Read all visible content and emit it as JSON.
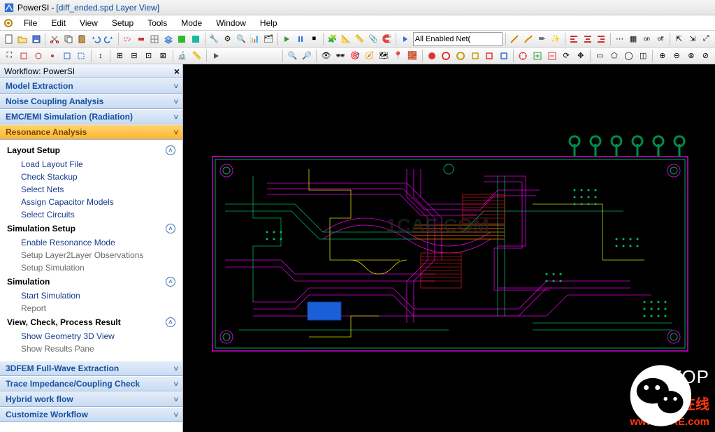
{
  "title": {
    "app": "PowerSI",
    "doc": "[diff_ended.spd Layer View]"
  },
  "menu": [
    "File",
    "Edit",
    "View",
    "Setup",
    "Tools",
    "Mode",
    "Window",
    "Help"
  ],
  "combo_nets": "All Enabled Net(",
  "workflow": {
    "title": "Workflow: PowerSI",
    "headers": [
      {
        "id": "model",
        "label": "Model Extraction"
      },
      {
        "id": "noise",
        "label": "Noise Coupling Analysis"
      },
      {
        "id": "emc",
        "label": "EMC/EMI Simulation (Radiation)"
      },
      {
        "id": "res",
        "label": "Resonance Analysis",
        "active": true
      },
      {
        "id": "fem",
        "label": "3DFEM Full-Wave Extraction"
      },
      {
        "id": "trace",
        "label": "Trace Impedance/Coupling Check"
      },
      {
        "id": "hyb",
        "label": "Hybrid work flow"
      },
      {
        "id": "cust",
        "label": "Customize Workflow"
      }
    ],
    "resonance": {
      "layout_setup": {
        "title": "Layout Setup",
        "items": [
          "Load Layout File",
          "Check Stackup",
          "Select Nets",
          "Assign Capacitor Models",
          "Select Circuits"
        ]
      },
      "sim_setup": {
        "title": "Simulation Setup",
        "items": [
          {
            "t": "Enable Resonance Mode",
            "m": false
          },
          {
            "t": "Setup Layer2Layer Observations",
            "m": true
          },
          {
            "t": "Setup Simulation",
            "m": true
          }
        ]
      },
      "simulation": {
        "title": "Simulation",
        "items": [
          {
            "t": "Start Simulation",
            "m": false
          },
          {
            "t": "Report",
            "m": true
          }
        ]
      },
      "view": {
        "title": "View, Check, Process Result",
        "items": [
          {
            "t": "Show Geometry 3D View",
            "m": false
          },
          {
            "t": "Show Results Pane",
            "m": true
          }
        ]
      }
    }
  },
  "watermark": {
    "brand": "EETOP",
    "cn": "仿真在线",
    "url": "www.1CAE.com",
    "center": "1CAE.COM"
  }
}
